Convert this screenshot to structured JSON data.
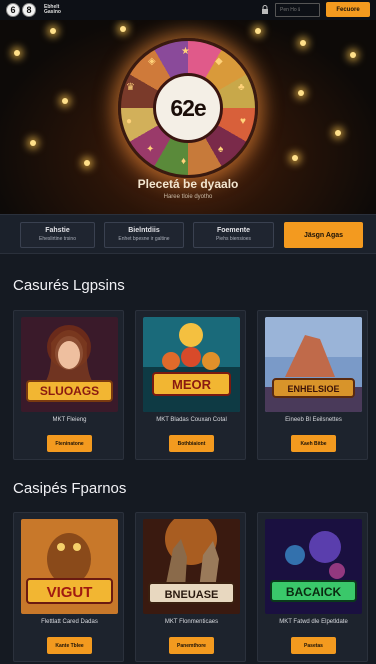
{
  "header": {
    "logo_glyphs": "68",
    "logo_text_1": "Ebhelt",
    "logo_text_2": "Gasino",
    "search_placeholder": "Pen Ho ℹ",
    "cta_label": "Fecuore",
    "lock_icon": "lock-icon"
  },
  "hero": {
    "wheel_value": "62e",
    "title": "Plecetá be dyaalo",
    "subtitle": "Haree tloie dyotho"
  },
  "tabs": [
    {
      "label": "Fahstie",
      "sub": "Eheslirtine trsino"
    },
    {
      "label": "Bielntdiis",
      "sub": "Enhet bpesne ir galtine"
    },
    {
      "label": "Foemente",
      "sub": "Piehs biensioes"
    }
  ],
  "cta": {
    "label": "Jäsgn Agas"
  },
  "section1": {
    "title": "Casurés Lgpsins",
    "cards": [
      {
        "name": "MKT Fleieng",
        "art": "SLUOAGS",
        "button": "Fteninatone"
      },
      {
        "name": "MKT Bladas Couxan Cotal",
        "art": "MEOR",
        "button": "Bothbiaiont"
      },
      {
        "name": "Eineeb Bl Eeilsnettes",
        "art": "ENHELSIOE",
        "button": "Kaeh Bitbe"
      }
    ]
  },
  "section2": {
    "title": "Casipés Fparnos",
    "cards": [
      {
        "name": "Flettlatt Cared Dadas",
        "art": "VIGUT",
        "button": "Kante Tblee"
      },
      {
        "name": "MKT Flonmenticaes",
        "art": "BNEUASE",
        "button": "Panemthore"
      },
      {
        "name": "MKT Fatwd dle Elpetldate",
        "art": "BACAICK",
        "button": "Pasetas"
      }
    ]
  }
}
